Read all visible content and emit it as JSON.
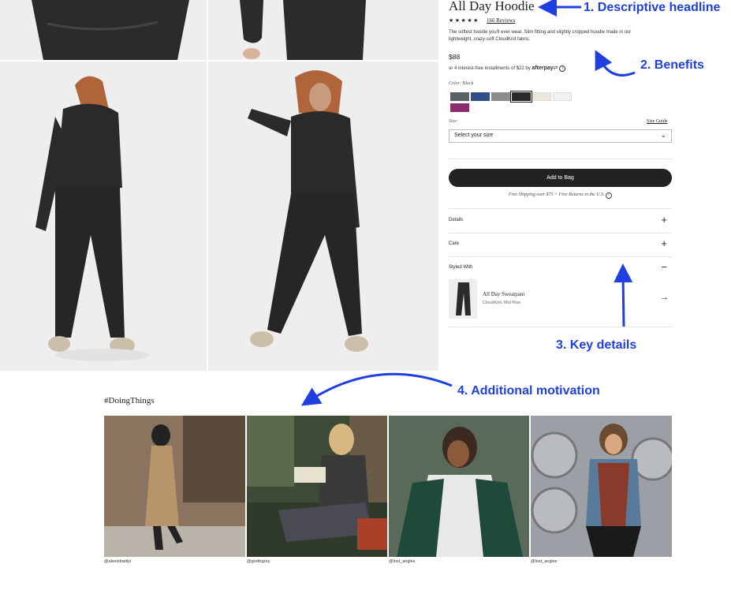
{
  "product": {
    "title": "All Day Hoodie",
    "stars": "★★★★★",
    "reviews": "166 Reviews",
    "description": "The softest hoodie you'll ever wear. Slim fitting and slightly cropped hoodie made in our lightweight, crazy-soft CloudKnit fabric.",
    "price": "$88",
    "installments": "or 4 interest-free installments of $22 by",
    "afterpay_logo": "afterpay",
    "afterpay_icon": "info-icon",
    "color_label": "Color:",
    "color_value": "Black",
    "swatches": [
      "#5a6069",
      "#2f4f86",
      "#8d8d8d",
      "#2a2a2a",
      "#ece6da",
      "#f1f1f1",
      "#8c2e6e"
    ],
    "size_label": "Size:",
    "size_guide": "Size Guide",
    "size_select_value": "Select your size",
    "add_to_bag": "Add to Bag",
    "shipping_note": "Free Shipping over $75 + Free Returns in the U.S.",
    "accordions": [
      {
        "label": "Details",
        "icon": "plus"
      },
      {
        "label": "Care",
        "icon": "plus"
      },
      {
        "label": "Styled With",
        "icon": "minus"
      }
    ],
    "styled_with": {
      "name": "All Day Sweatpant",
      "subtitle": "CloudKnit; Mid Rise"
    }
  },
  "gallery": {
    "hashtag": "#DoingThings",
    "handles": [
      "@alexisbadiyi",
      "@godisgrey",
      "@lost_angles",
      "@lost_angles"
    ]
  },
  "annotations": {
    "a1": "1. Descriptive headline",
    "a2": "2. Benefits",
    "a3": "3. Key details",
    "a4": "4. Additional motivation"
  },
  "colors": {
    "annotation_blue": "#1f3fe0",
    "button_bg": "#222222"
  }
}
